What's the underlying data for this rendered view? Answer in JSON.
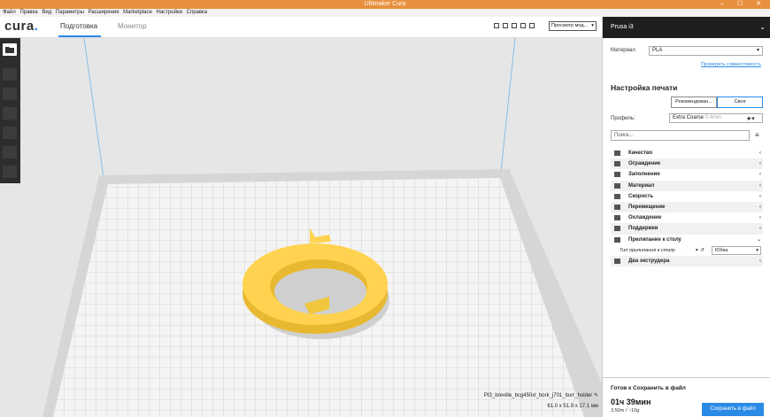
{
  "window": {
    "title": "Ultimaker Cura",
    "minimize": "–",
    "maximize": "☐",
    "close": "✕"
  },
  "menu": [
    "Файл",
    "Правка",
    "Вид",
    "Параметры",
    "Расширения",
    "Marketplace",
    "Настройки",
    "Справка"
  ],
  "topbar": {
    "logo": "cura",
    "tabs": [
      "Подготовка",
      "Монитор"
    ],
    "view_select": "Просмотр мод..."
  },
  "colors": {
    "accent": "#2a8be6",
    "titlebar": "#e9903f",
    "model": "#ffd34f",
    "toolbar": "#2d2d2d"
  },
  "icons": {
    "toolbar": [
      "open-file-icon",
      "move-icon",
      "scale-icon",
      "rotate-icon",
      "mirror-icon",
      "per-model-settings-icon",
      "support-blocker-icon"
    ],
    "view": [
      "3d-view-icon",
      "front-view-icon",
      "top-view-icon",
      "left-view-icon",
      "right-view-icon"
    ]
  },
  "model": {
    "filename": "PI3_breville_bcg450xl_bork_j701_burr_holder",
    "dimensions": "61.0 x 51.9 x 17.1 мм"
  },
  "panel": {
    "printer": "Prusa i3",
    "material_label": "Материал",
    "material_value": "PLA",
    "compat_link": "Проверить совместимость",
    "section_title": "Настройка печати",
    "mode_recommended": "Рекомендован...",
    "mode_custom": "Своя",
    "profile_label": "Профиль:",
    "profile_value": "Extra Coarse",
    "profile_hint": "0.4mm",
    "search_placeholder": "Поиск...",
    "settings": [
      {
        "label": "Качество",
        "icon": "quality-icon"
      },
      {
        "label": "Ограждение",
        "icon": "shell-icon"
      },
      {
        "label": "Заполнение",
        "icon": "infill-icon"
      },
      {
        "label": "Материал",
        "icon": "material-icon"
      },
      {
        "label": "Скорость",
        "icon": "speed-icon"
      },
      {
        "label": "Перемещение",
        "icon": "travel-icon"
      },
      {
        "label": "Охлаждение",
        "icon": "cooling-icon"
      },
      {
        "label": "Поддержки",
        "icon": "support-icon"
      },
      {
        "label": "Прилипание к столу",
        "icon": "adhesion-icon",
        "expanded": true
      }
    ],
    "adhesion_type_label": "Тип прилипания к столу",
    "adhesion_type_value": "Юбка",
    "dual_extrusion": "Два экструдера",
    "status": "Готов к Сохранить в файл",
    "print_time": "01ч 39мин",
    "filament": "3.50m / ~10g",
    "save_button": "Сохранить в файл"
  }
}
